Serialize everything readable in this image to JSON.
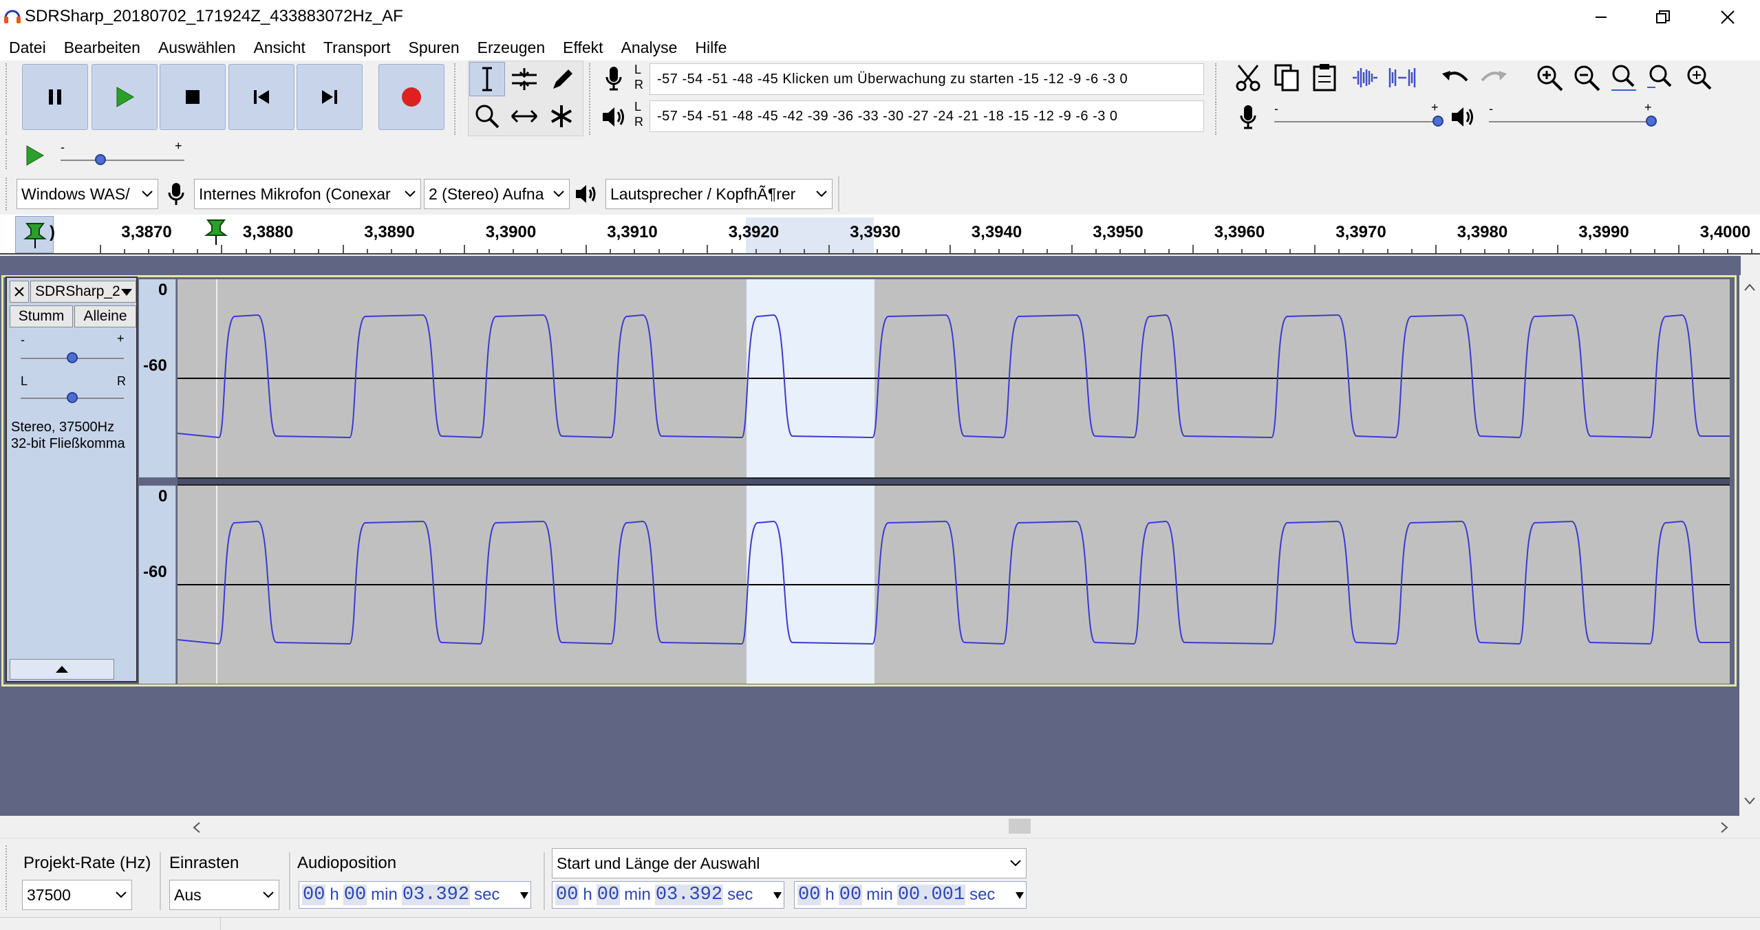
{
  "window": {
    "title": "SDRSharp_20180702_171924Z_433883072Hz_AF",
    "controls": [
      "minimize",
      "maximize",
      "close"
    ]
  },
  "menu": [
    "Datei",
    "Bearbeiten",
    "Auswählen",
    "Ansicht",
    "Transport",
    "Spuren",
    "Erzeugen",
    "Effekt",
    "Analyse",
    "Hilfe"
  ],
  "meters": {
    "record": {
      "channels": "L\nR",
      "text": "-57 -54 -51 -48 -45 Klicken um Überwachung zu starten -15 -12  -9  -6  -3  0"
    },
    "playback": {
      "channels": "L\nR",
      "text": "-57 -54 -51 -48 -45 -42 -39 -36 -33 -30 -27 -24 -21 -18 -15 -12  -9  -6  -3  0"
    }
  },
  "mixer": {
    "record_minus": "-",
    "record_plus": "+",
    "play_minus": "-",
    "play_plus": "+"
  },
  "playspeed": {
    "minus": "-",
    "plus": "+"
  },
  "devices": {
    "host": "Windows WAS/",
    "recording_device": "Internes Mikrofon (Conexar",
    "channels": "2 (Stereo) Aufna",
    "playback_device": "Lautsprecher / KopfhÃ¶rer"
  },
  "ruler": {
    "first_label": ")",
    "labels": [
      "3,3870",
      "3,3880",
      "3,3890",
      "3,3900",
      "3,3910",
      "3,3920",
      "3,3930",
      "3,3940",
      "3,3950",
      "3,3960",
      "3,3970",
      "3,3980",
      "3,3990",
      "3,4000"
    ]
  },
  "track": {
    "name": "SDRSharp_2",
    "mute": "Stumm",
    "solo": "Alleine",
    "gain_minus": "-",
    "gain_plus": "+",
    "pan_left": "L",
    "pan_right": "R",
    "info_line1": "Stereo, 37500Hz",
    "info_line2": "32-bit Fließkomma",
    "scale_top": "0",
    "scale_mid": "-60"
  },
  "bottom": {
    "project_rate_label": "Projekt-Rate (Hz)",
    "project_rate_value": "37500",
    "snap_label": "Einrasten",
    "snap_value": "Aus",
    "audio_position_label": "Audioposition",
    "selection_mode": "Start und Länge der Auswahl",
    "audio_position": {
      "h": "00",
      "m": "00",
      "s": "03.392"
    },
    "selection_start": {
      "h": "00",
      "m": "00",
      "s": "03.392"
    },
    "selection_length": {
      "h": "00",
      "m": "00",
      "s": "00.001"
    },
    "unit_h": "h",
    "unit_min": "min",
    "unit_sec": "sec"
  },
  "colors": {
    "waveform": "#3a3ad0",
    "clip_background": "#c0c0c0",
    "selection": "#e8f0fb",
    "track_background": "#606584",
    "track_panel": "#c6d4ea",
    "record_button": "#e02020",
    "play_button": "#2aa02a"
  }
}
